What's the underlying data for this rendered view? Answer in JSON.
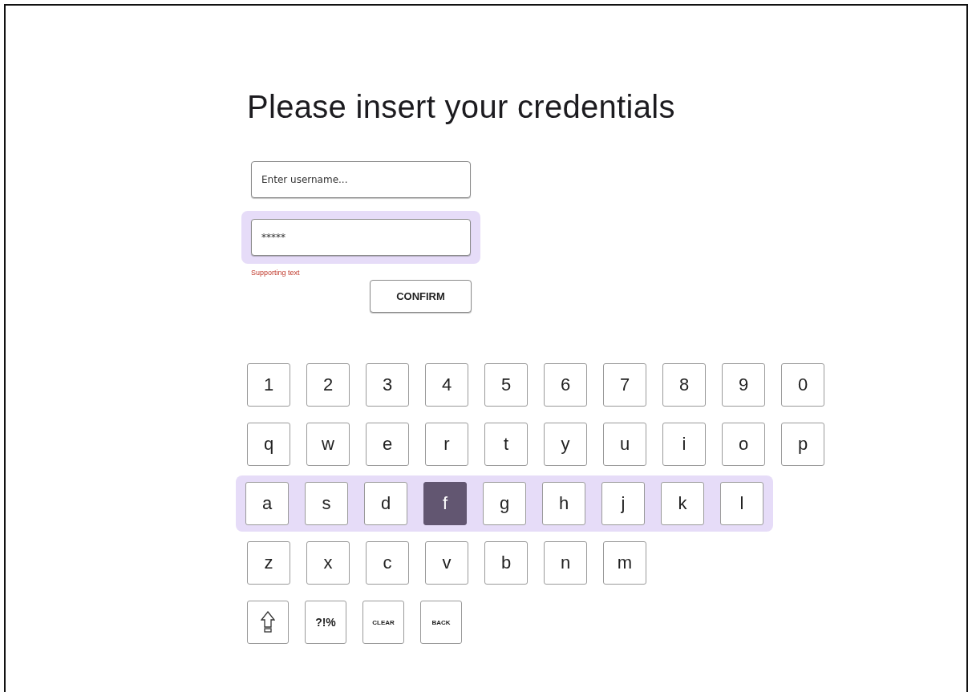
{
  "title": "Please insert your credentials",
  "username": {
    "placeholder": "Enter username...",
    "focused": false
  },
  "password": {
    "value": "*****",
    "focused": true,
    "supporting_text": "Supporting text"
  },
  "confirm_button": "CONFIRM",
  "keyboard": {
    "rows": [
      {
        "highlighted": false,
        "keys": [
          {
            "kind": "char",
            "label": "1",
            "selected": false
          },
          {
            "kind": "char",
            "label": "2",
            "selected": false
          },
          {
            "kind": "char",
            "label": "3",
            "selected": false
          },
          {
            "kind": "char",
            "label": "4",
            "selected": false
          },
          {
            "kind": "char",
            "label": "5",
            "selected": false
          },
          {
            "kind": "char",
            "label": "6",
            "selected": false
          },
          {
            "kind": "char",
            "label": "7",
            "selected": false
          },
          {
            "kind": "char",
            "label": "8",
            "selected": false
          },
          {
            "kind": "char",
            "label": "9",
            "selected": false
          },
          {
            "kind": "char",
            "label": "0",
            "selected": false
          }
        ]
      },
      {
        "highlighted": false,
        "keys": [
          {
            "kind": "char",
            "label": "q",
            "selected": false
          },
          {
            "kind": "char",
            "label": "w",
            "selected": false
          },
          {
            "kind": "char",
            "label": "e",
            "selected": false
          },
          {
            "kind": "char",
            "label": "r",
            "selected": false
          },
          {
            "kind": "char",
            "label": "t",
            "selected": false
          },
          {
            "kind": "char",
            "label": "y",
            "selected": false
          },
          {
            "kind": "char",
            "label": "u",
            "selected": false
          },
          {
            "kind": "char",
            "label": "i",
            "selected": false
          },
          {
            "kind": "char",
            "label": "o",
            "selected": false
          },
          {
            "kind": "char",
            "label": "p",
            "selected": false
          }
        ]
      },
      {
        "highlighted": true,
        "keys": [
          {
            "kind": "char",
            "label": "a",
            "selected": false
          },
          {
            "kind": "char",
            "label": "s",
            "selected": false
          },
          {
            "kind": "char",
            "label": "d",
            "selected": false
          },
          {
            "kind": "char",
            "label": "f",
            "selected": true
          },
          {
            "kind": "char",
            "label": "g",
            "selected": false
          },
          {
            "kind": "char",
            "label": "h",
            "selected": false
          },
          {
            "kind": "char",
            "label": "j",
            "selected": false
          },
          {
            "kind": "char",
            "label": "k",
            "selected": false
          },
          {
            "kind": "char",
            "label": "l",
            "selected": false
          }
        ]
      },
      {
        "highlighted": false,
        "keys": [
          {
            "kind": "char",
            "label": "z",
            "selected": false
          },
          {
            "kind": "char",
            "label": "x",
            "selected": false
          },
          {
            "kind": "char",
            "label": "c",
            "selected": false
          },
          {
            "kind": "char",
            "label": "v",
            "selected": false
          },
          {
            "kind": "char",
            "label": "b",
            "selected": false
          },
          {
            "kind": "char",
            "label": "n",
            "selected": false
          },
          {
            "kind": "char",
            "label": "m",
            "selected": false
          }
        ]
      },
      {
        "highlighted": false,
        "keys": [
          {
            "kind": "shift",
            "selected": false
          },
          {
            "kind": "symbols",
            "label": "?!%",
            "selected": false
          },
          {
            "kind": "command",
            "label": "CLEAR",
            "selected": false
          },
          {
            "kind": "command",
            "label": "BACK",
            "selected": false
          }
        ]
      }
    ]
  }
}
